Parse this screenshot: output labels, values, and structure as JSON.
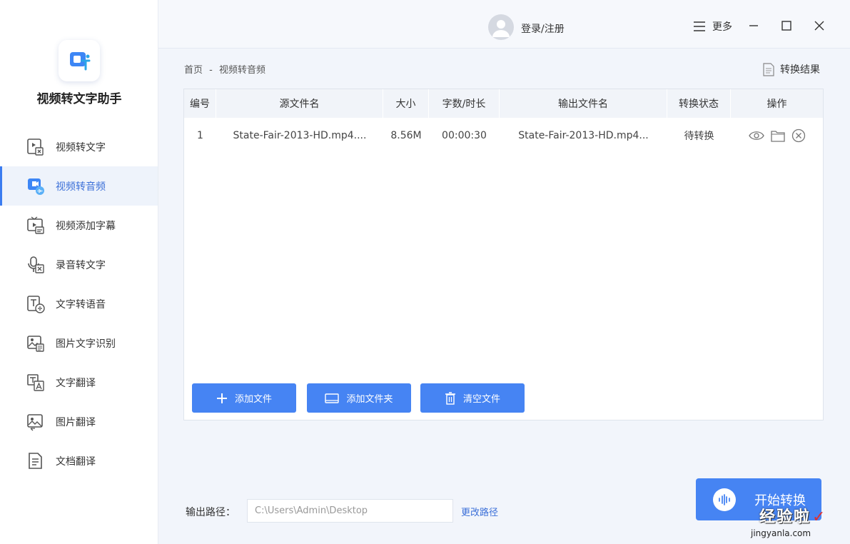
{
  "app": {
    "name": "视频转文字助手"
  },
  "sidebar": {
    "items": [
      {
        "label": "视频转文字",
        "icon": "video-to-text-icon",
        "active": false
      },
      {
        "label": "视频转音频",
        "icon": "video-to-audio-icon",
        "active": true
      },
      {
        "label": "视频添加字幕",
        "icon": "video-subtitle-icon",
        "active": false
      },
      {
        "label": "录音转文字",
        "icon": "microphone-text-icon",
        "active": false
      },
      {
        "label": "文字转语音",
        "icon": "text-to-speech-icon",
        "active": false
      },
      {
        "label": "图片文字识别",
        "icon": "image-ocr-icon",
        "active": false
      },
      {
        "label": "文字翻译",
        "icon": "text-translate-icon",
        "active": false
      },
      {
        "label": "图片翻译",
        "icon": "image-translate-icon",
        "active": false
      },
      {
        "label": "文档翻译",
        "icon": "document-translate-icon",
        "active": false
      }
    ]
  },
  "topbar": {
    "login": "登录/注册",
    "more": "更多"
  },
  "breadcrumb": {
    "home": "首页",
    "sep": "-",
    "current": "视频转音频"
  },
  "result_link": "转换结果",
  "table": {
    "headers": [
      "编号",
      "源文件名",
      "大小",
      "字数/时长",
      "输出文件名",
      "转换状态",
      "操作"
    ],
    "rows": [
      {
        "index": "1",
        "source": "State-Fair-2013-HD.mp4....",
        "size": "8.56M",
        "duration": "00:00:30",
        "output": "State-Fair-2013-HD.mp4...",
        "status": "待转换"
      }
    ]
  },
  "buttons": {
    "add_file": "添加文件",
    "add_folder": "添加文件夹",
    "clear_files": "清空文件",
    "start": "开始转换"
  },
  "output": {
    "label": "输出路径：",
    "path": "C:\\Users\\Admin\\Desktop",
    "change": "更改路径"
  },
  "watermark": {
    "main": "经验啦",
    "sub": "jingyanla.com"
  },
  "colors": {
    "accent": "#4684f3",
    "active_bg": "#eef3fb",
    "link": "#3b6fd8"
  }
}
